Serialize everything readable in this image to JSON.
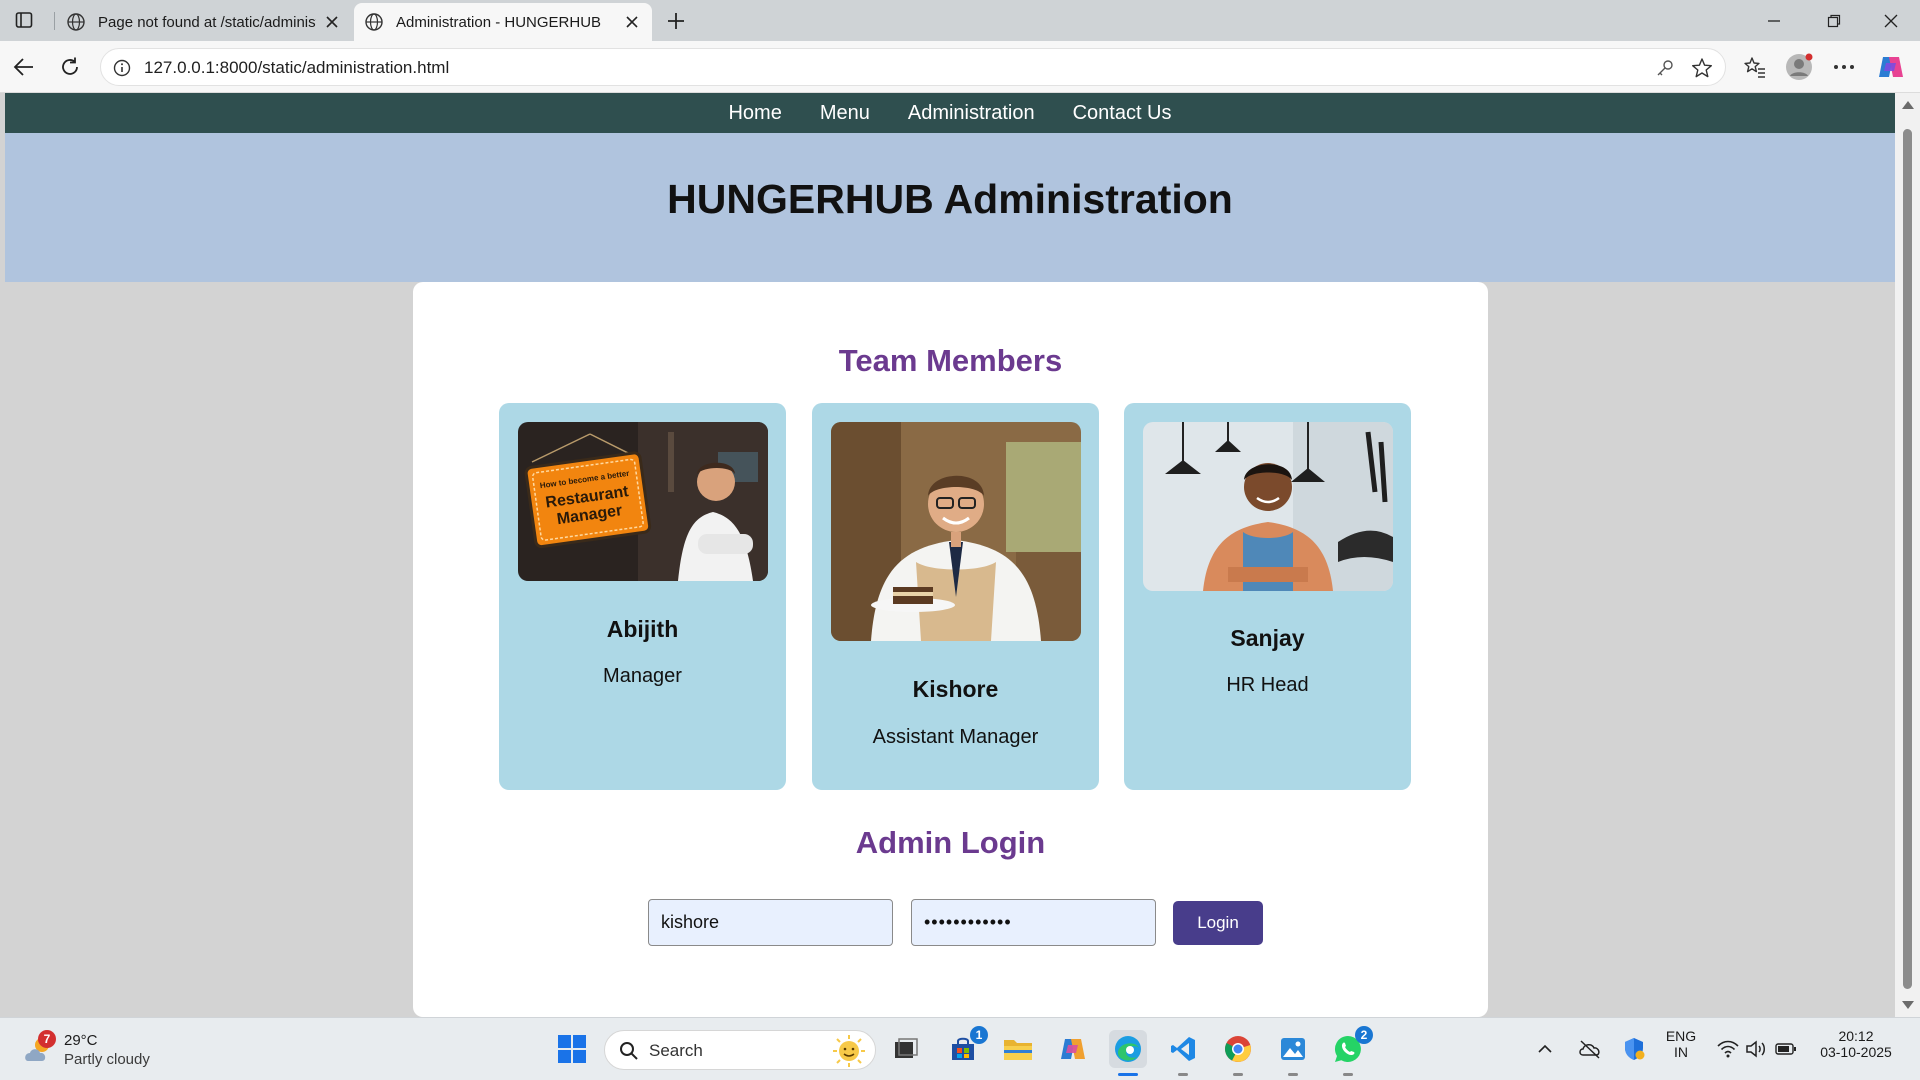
{
  "browser": {
    "tabs": [
      {
        "title": "Page not found at /static/administ",
        "active": false
      },
      {
        "title": "Administration - HUNGERHUB",
        "active": true
      }
    ],
    "url": "127.0.0.1:8000/static/administration.html"
  },
  "site": {
    "nav": [
      "Home",
      "Menu",
      "Administration",
      "Contact Us"
    ],
    "hero_title": "HUNGERHUB Administration",
    "team_title": "Team Members",
    "members": [
      {
        "name": "Abijith",
        "role": "Manager",
        "sign_text_1": "How to become a better",
        "sign_text_2": "Restaurant",
        "sign_text_3": "Manager"
      },
      {
        "name": "Kishore",
        "role": "Assistant Manager"
      },
      {
        "name": "Sanjay",
        "role": "HR Head"
      }
    ],
    "login": {
      "title": "Admin Login",
      "username_value": "kishore",
      "password_value": "••••••••••••",
      "button_label": "Login"
    }
  },
  "taskbar": {
    "weather_badge": "7",
    "temperature": "29°C",
    "condition": "Partly cloudy",
    "search_label": "Search",
    "store_badge": "1",
    "whatsapp_badge": "2",
    "lang_1": "ENG",
    "lang_2": "IN",
    "time": "20:12",
    "date": "03-10-2025"
  },
  "colors": {
    "nav_bg": "#2f4f4f",
    "hero_bg": "#b0c4de",
    "card_bg": "#add8e6",
    "heading_purple": "#6b3a8f",
    "login_button": "#483d8b"
  }
}
